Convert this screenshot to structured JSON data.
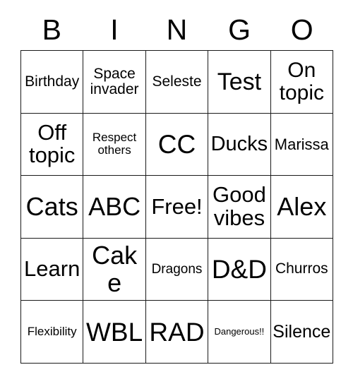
{
  "card": {
    "header_letters": [
      "B",
      "I",
      "N",
      "G",
      "O"
    ],
    "columns": 5,
    "rows": 5,
    "border_color": "#1a1a1a",
    "background_color": "#ffffff",
    "text_color": "#000000",
    "free_space_label": "Free!",
    "cells": [
      {
        "text": "Birthday",
        "size": "fs-21",
        "row": 1,
        "col": 1
      },
      {
        "text": "Space invader",
        "size": "fs-21",
        "row": 1,
        "col": 2
      },
      {
        "text": "Seleste",
        "size": "fs-21",
        "row": 1,
        "col": 3
      },
      {
        "text": "Test",
        "size": "fs-34",
        "row": 1,
        "col": 4
      },
      {
        "text": "On topic",
        "size": "fs-30",
        "row": 1,
        "col": 5
      },
      {
        "text": "Off topic",
        "size": "fs-31",
        "row": 2,
        "col": 1
      },
      {
        "text": "Respect others",
        "size": "fs-17",
        "row": 2,
        "col": 2
      },
      {
        "text": "CC",
        "size": "fs-37",
        "row": 2,
        "col": 3
      },
      {
        "text": "Ducks",
        "size": "fs-29",
        "row": 2,
        "col": 4
      },
      {
        "text": "Marissa",
        "size": "fs-22",
        "row": 2,
        "col": 5
      },
      {
        "text": "Cats",
        "size": "fs-36",
        "row": 3,
        "col": 1
      },
      {
        "text": "ABC",
        "size": "fs-36",
        "row": 3,
        "col": 2
      },
      {
        "text": "Free!",
        "size": "fs-31",
        "row": 3,
        "col": 3
      },
      {
        "text": "Good vibes",
        "size": "fs-31",
        "row": 3,
        "col": 4
      },
      {
        "text": "Alex",
        "size": "fs-36",
        "row": 3,
        "col": 5
      },
      {
        "text": "Learn",
        "size": "fs-31",
        "row": 4,
        "col": 1
      },
      {
        "text": "Cake",
        "size": "fs-36",
        "row": 4,
        "col": 2
      },
      {
        "text": "Dragons",
        "size": "fs-19",
        "row": 4,
        "col": 3
      },
      {
        "text": "D&D",
        "size": "fs-37",
        "row": 4,
        "col": 4
      },
      {
        "text": "Churros",
        "size": "fs-21",
        "row": 4,
        "col": 5
      },
      {
        "text": "Flexibility",
        "size": "fs-17",
        "row": 5,
        "col": 1
      },
      {
        "text": "WBL",
        "size": "fs-37",
        "row": 5,
        "col": 2
      },
      {
        "text": "RAD",
        "size": "fs-37",
        "row": 5,
        "col": 3
      },
      {
        "text": "Dangerous!!",
        "size": "fs-13",
        "row": 5,
        "col": 4
      },
      {
        "text": "Silence",
        "size": "fs-25",
        "row": 5,
        "col": 5
      }
    ]
  }
}
